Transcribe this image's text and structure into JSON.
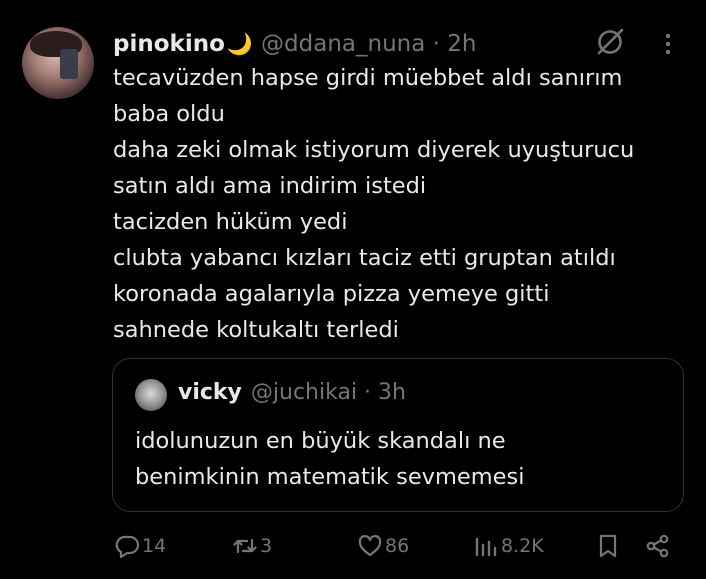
{
  "tweet": {
    "author_name": "pinokino",
    "author_emoji": "🌙",
    "handle_line": "@ddana_nuna · 2h",
    "lines": [
      "tecavüzden hapse girdi müebbet aldı sanırım",
      "baba oldu",
      "daha zeki olmak istiyorum diyerek uyuşturucu",
      "satın aldı ama indirim istedi",
      "tacizden hüküm yedi",
      "clubta yabancı kızları taciz etti gruptan atıldı",
      "koronada agalarıyla pizza yemeye gitti",
      "sahnede koltukaltı terledi"
    ]
  },
  "quote": {
    "author_name": "vicky",
    "handle_line": "@juchikai · 3h",
    "lines": [
      "idolunuzun en büyük skandalı ne",
      "benimkinin matematik sevmemesi"
    ]
  },
  "actions": {
    "replies": "14",
    "retweets": "3",
    "likes": "86",
    "views": "8.2K"
  },
  "colors": {
    "background": "#000000",
    "text": "#e7e9ea",
    "muted": "#71767b",
    "border": "#2f3336"
  },
  "icons": [
    "grok-icon",
    "more-icon",
    "reply-icon",
    "retweet-icon",
    "like-icon",
    "views-icon",
    "bookmark-icon",
    "share-icon"
  ]
}
